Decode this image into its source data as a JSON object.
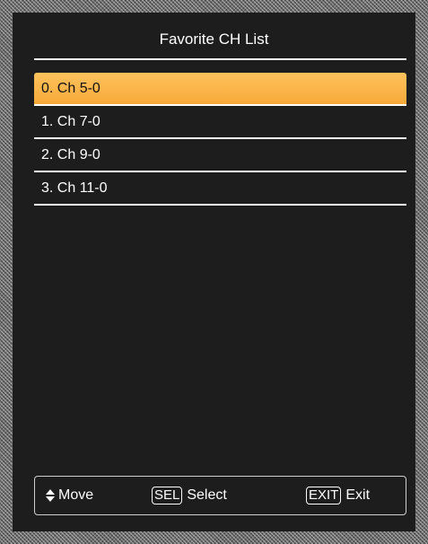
{
  "menu": {
    "title": "Favorite CH List",
    "items": [
      {
        "label": "0. Ch 5-0",
        "selected": true
      },
      {
        "label": "1. Ch 7-0",
        "selected": false
      },
      {
        "label": "2. Ch 9-0",
        "selected": false
      },
      {
        "label": "3. Ch 11-0",
        "selected": false
      }
    ]
  },
  "footer": {
    "move": {
      "icon": "up-down-arrow-icon",
      "label": "Move"
    },
    "select": {
      "key": "SEL",
      "label": "Select"
    },
    "exit": {
      "key": "EXIT",
      "label": "Exit"
    }
  },
  "colors": {
    "background": "#1d1d1d",
    "highlight": "#f7a93a",
    "text": "#ffffff"
  }
}
